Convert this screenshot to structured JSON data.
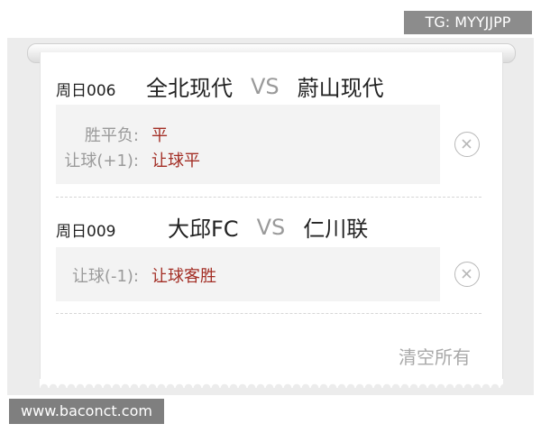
{
  "watermarks": {
    "tg": "TG: MYYJJPP",
    "site": "www.baconct.com"
  },
  "matches": [
    {
      "id": "周日006",
      "home": "全北现代",
      "vs": "VS",
      "away": "蔚山现代",
      "bets": [
        {
          "label": "胜平负:",
          "value": "平"
        },
        {
          "label": "让球(+1):",
          "value": "让球平"
        }
      ]
    },
    {
      "id": "周日009",
      "home": "大邱FC",
      "vs": "VS",
      "away": "仁川联",
      "bets": [
        {
          "label": "让球(-1):",
          "value": "让球客胜"
        }
      ]
    }
  ],
  "actions": {
    "clear_all": "清空所有"
  },
  "colors": {
    "accent": "#a32e25",
    "muted": "#9a9a9a",
    "box_bg": "#f3f3f3"
  },
  "icons": {
    "remove": "close-circle-icon"
  }
}
